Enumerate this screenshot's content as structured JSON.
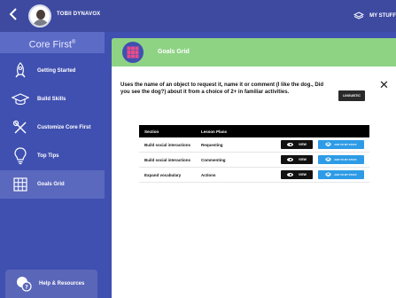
{
  "topbar": {
    "back_icon": "chevron-left-icon",
    "username": "TOBII DYNAVOX",
    "my_stuff": "MY STUFF"
  },
  "sidebar": {
    "title": "Core First",
    "title_mark": "®",
    "items": [
      {
        "label": "Getting Started",
        "icon": "rocket-icon"
      },
      {
        "label": "Build Skills",
        "icon": "graduation-cap-icon"
      },
      {
        "label": "Customize Core First",
        "icon": "tools-icon"
      },
      {
        "label": "Top Tips",
        "icon": "lightbulb-icon"
      },
      {
        "label": "Goals Grid",
        "icon": "grid-icon",
        "active": true
      }
    ],
    "help": "Help & Resources"
  },
  "panel": {
    "title": "Goals Grid",
    "description": "Uses the name of an object to request it, name it or comment (I like the dog., Did you see the dog?) about it from a choice of 2+ in familiar activities.",
    "linguistic": "LINGUISTIC",
    "table": {
      "headers": [
        "Section",
        "Lesson Plans"
      ],
      "view_label": "VIEW",
      "add_label": "ADD TO MY STUFF",
      "rows": [
        {
          "section": "Build social interactions",
          "plan": "Requesting"
        },
        {
          "section": "Build social interactions",
          "plan": "Commenting"
        },
        {
          "section": "Expand vocabulary",
          "plan": "Actions"
        }
      ]
    }
  },
  "colors": {
    "topbar": "#3d4aa0",
    "sidebar": "#4050b0",
    "header_green": "#8ed384",
    "add_button": "#2e9be6"
  }
}
